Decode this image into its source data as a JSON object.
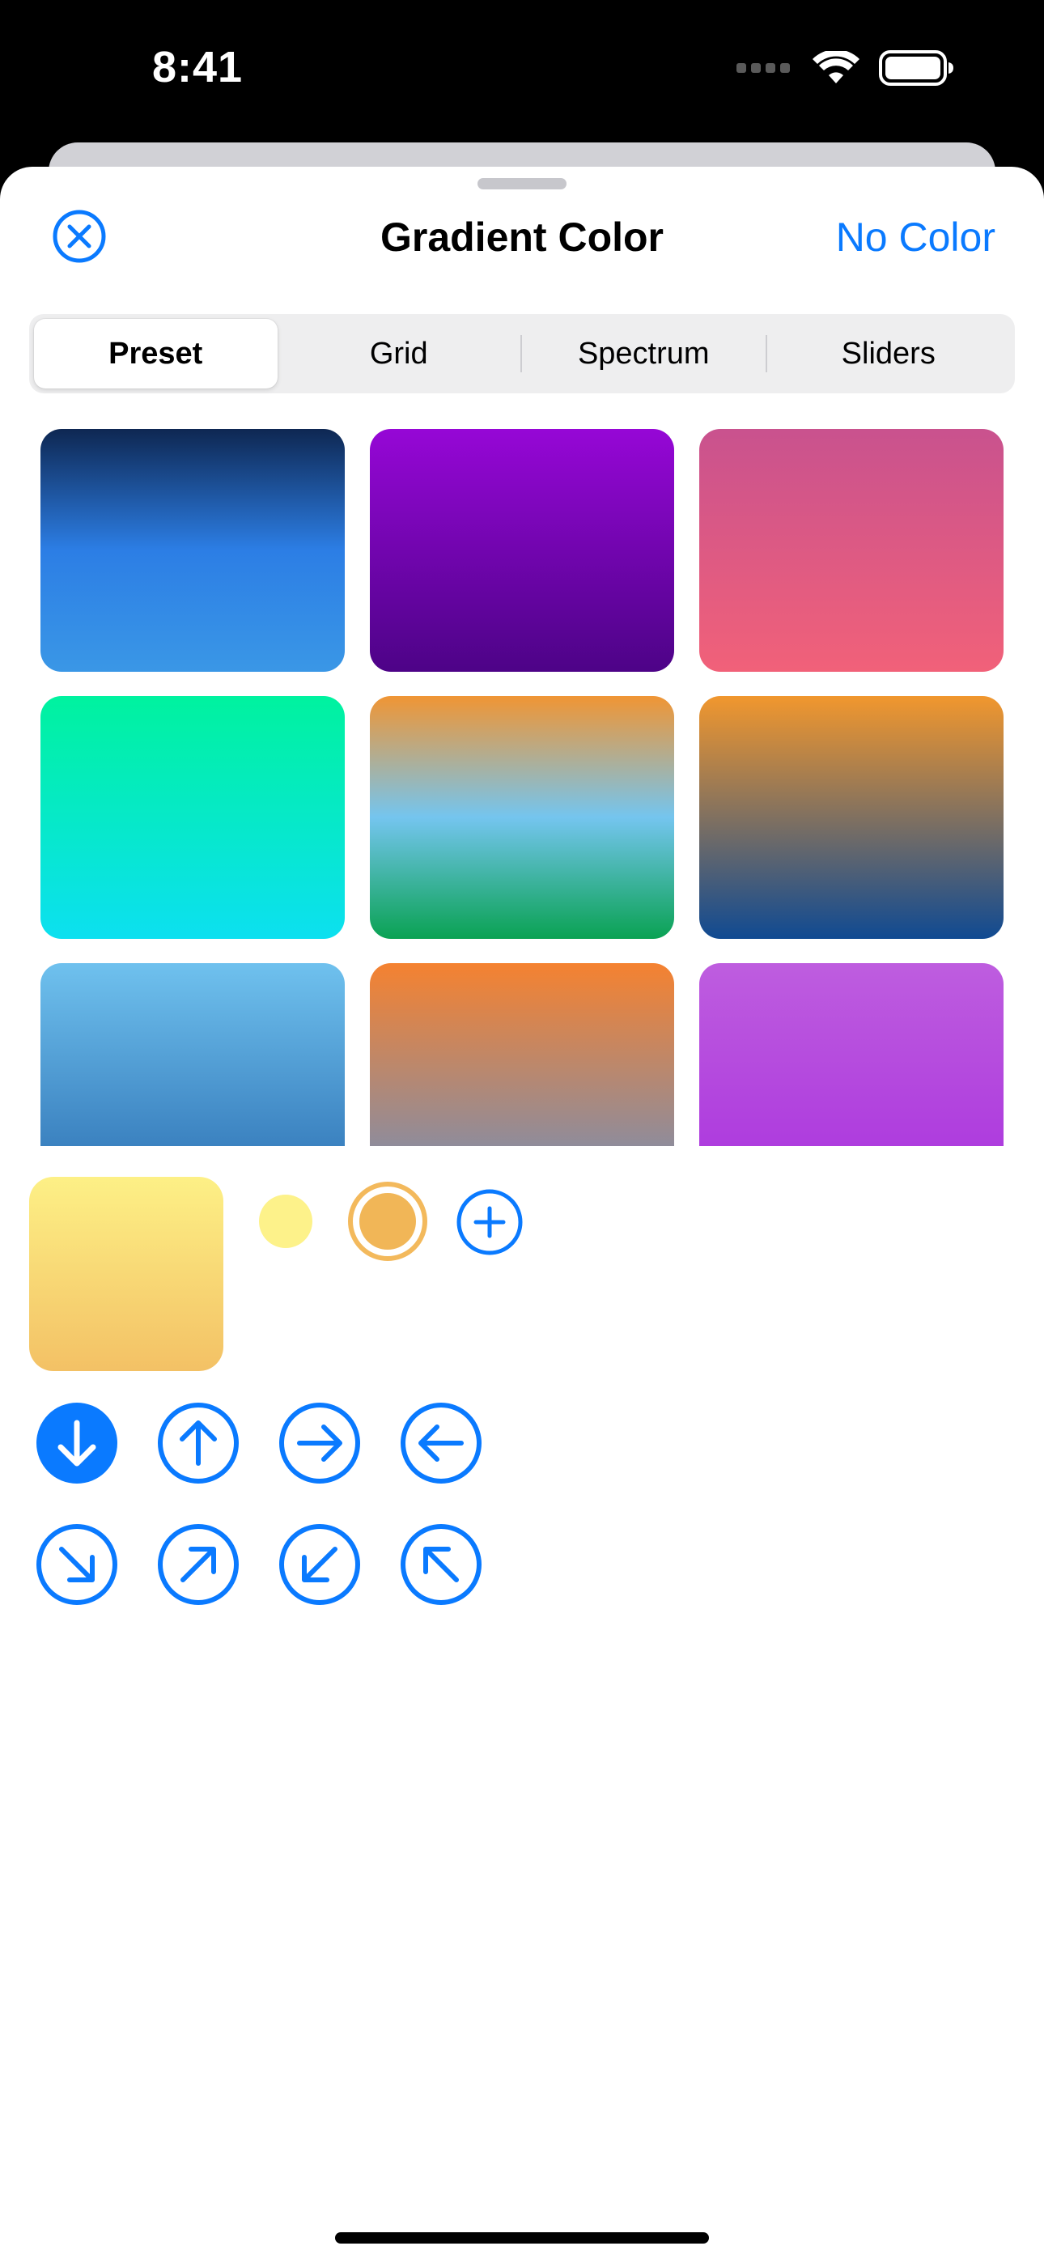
{
  "status_bar": {
    "time": "8:41"
  },
  "header": {
    "title": "Gradient Color",
    "no_color_label": "No Color",
    "close_icon": "close-circle-icon"
  },
  "segments": [
    {
      "label": "Preset",
      "selected": true
    },
    {
      "label": "Grid",
      "selected": false
    },
    {
      "label": "Spectrum",
      "selected": false
    },
    {
      "label": "Sliders",
      "selected": false
    }
  ],
  "presets": [
    {
      "colors": [
        "#0e2752",
        "#2c7ee5",
        "#3a97e6"
      ]
    },
    {
      "colors": [
        "#9607d6",
        "#4d0387"
      ]
    },
    {
      "colors": [
        "#c9528e",
        "#f16179"
      ]
    },
    {
      "colors": [
        "#00f29f",
        "#0ce0f0"
      ]
    },
    {
      "colors": [
        "#f09534",
        "#74c5ef",
        "#0aa253"
      ]
    },
    {
      "colors": [
        "#f1972e",
        "#104a92"
      ]
    },
    {
      "colors": [
        "#6fc1ee",
        "#2a6db1"
      ]
    },
    {
      "colors": [
        "#f58230",
        "#6e8fbd"
      ]
    },
    {
      "colors": [
        "#be5ddf",
        "#a932dd"
      ]
    }
  ],
  "gradient_stops": {
    "preview_colors": [
      "#fdf086",
      "#f3c165"
    ],
    "stops": [
      {
        "color": "#fdf28a",
        "selected": false
      },
      {
        "color": "#f1b657",
        "selected": true
      }
    ],
    "add_icon": "plus-circle-icon"
  },
  "directions": [
    {
      "icon": "arrow-down-icon",
      "selected": true
    },
    {
      "icon": "arrow-up-icon",
      "selected": false
    },
    {
      "icon": "arrow-right-icon",
      "selected": false
    },
    {
      "icon": "arrow-left-icon",
      "selected": false
    },
    {
      "icon": "arrow-down-right-icon",
      "selected": false
    },
    {
      "icon": "arrow-up-right-icon",
      "selected": false
    },
    {
      "icon": "arrow-down-left-icon",
      "selected": false
    },
    {
      "icon": "arrow-up-left-icon",
      "selected": false
    }
  ],
  "accent_color": "#0a7aff"
}
